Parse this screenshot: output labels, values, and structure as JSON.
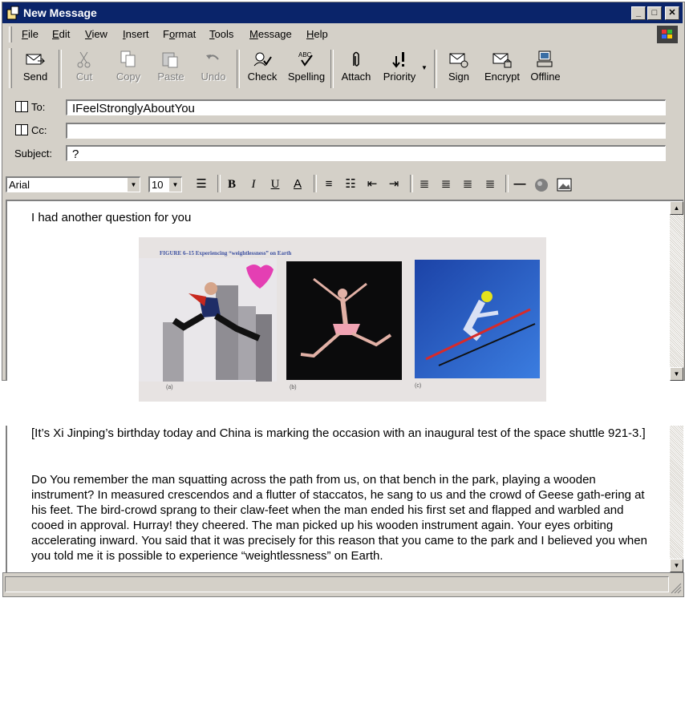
{
  "window": {
    "title": "New Message"
  },
  "menu": [
    "File",
    "Edit",
    "View",
    "Insert",
    "Format",
    "Tools",
    "Message",
    "Help"
  ],
  "menu_access": [
    "F",
    "E",
    "V",
    "I",
    "o",
    "T",
    "M",
    "H"
  ],
  "toolbar": {
    "send": "Send",
    "cut": "Cut",
    "copy": "Copy",
    "paste": "Paste",
    "undo": "Undo",
    "check": "Check",
    "spelling": "Spelling",
    "spelling_icon_text": "ABC",
    "attach": "Attach",
    "priority": "Priority",
    "sign": "Sign",
    "encrypt": "Encrypt",
    "offline": "Offline"
  },
  "fields": {
    "to_label": "To:",
    "to_value": "IFeelStronglyAboutYou",
    "cc_label": "Cc:",
    "cc_value": "",
    "subject_label": "Subject:",
    "subject_value": "?"
  },
  "format": {
    "font": "Arial",
    "size": "10"
  },
  "body": {
    "intro": "I had another question for you",
    "figure_caption": "FIGURE 6–15   Experiencing “weightlessness” on Earth",
    "panel_labels": [
      "(a)",
      "(b)",
      "(c)"
    ],
    "p1": "[It’s Xi Jinping’s birthday today and China is marking the occasion with an inaugural test of the space shuttle 921-3.]",
    "p2": "Do You remember the man squatting across the path from us, on that bench in the park, playing a wooden instrument? In measured crescendos and a flutter of staccatos, he sang to us and the crowd of Geese gath-ering at his feet. The bird-crowd sprang to their claw-feet when the man ended his first set and flapped and warbled and cooed in approval. Hurray! they cheered. The man picked up his wooden instrument again. Your eyes orbiting accelerating inward. You said that it was precisely for this reason that you came to the park and I believed you when you told me it is possible to experience “weightlessness” on Earth."
  }
}
